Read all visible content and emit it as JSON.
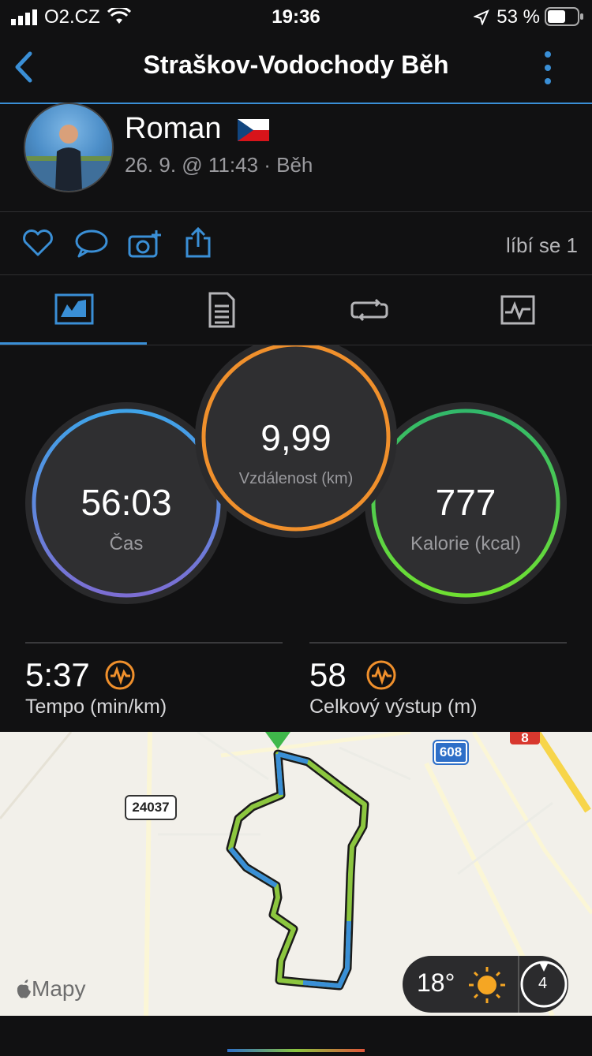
{
  "status_bar": {
    "carrier": "O2.CZ",
    "time": "19:36",
    "battery_percent": "53 %"
  },
  "header": {
    "title": "Straškov-Vodochody Běh"
  },
  "profile": {
    "name": "Roman",
    "subline": "26. 9. @ 11:43 · Běh"
  },
  "social": {
    "likes_text": "líbí se 1"
  },
  "tabs": [
    {
      "icon": "overview-icon",
      "selected": true
    },
    {
      "icon": "details-icon",
      "selected": false
    },
    {
      "icon": "laps-icon",
      "selected": false
    },
    {
      "icon": "charts-icon",
      "selected": false
    }
  ],
  "metrics": {
    "time": {
      "value": "56:03",
      "label": "Čas"
    },
    "distance": {
      "value": "9,99",
      "label": "Vzdálenost (km)"
    },
    "calories": {
      "value": "777",
      "label": "Kalorie (kcal)"
    },
    "pace": {
      "value": "5:37",
      "label": "Tempo (min/km)"
    },
    "ascent": {
      "value": "58",
      "label": "Celkový výstup (m)"
    }
  },
  "map": {
    "road_labels": [
      "24037",
      "608",
      "8"
    ],
    "attribution": "Mapy",
    "weather": {
      "temperature": "18°",
      "wind": "4"
    }
  },
  "colors": {
    "accent": "#3a8fd6",
    "ring_time": "#6a7fd6",
    "ring_distance": "#f0902c",
    "ring_calories": "#4fd34a",
    "stat_icon": "#f0902c"
  }
}
